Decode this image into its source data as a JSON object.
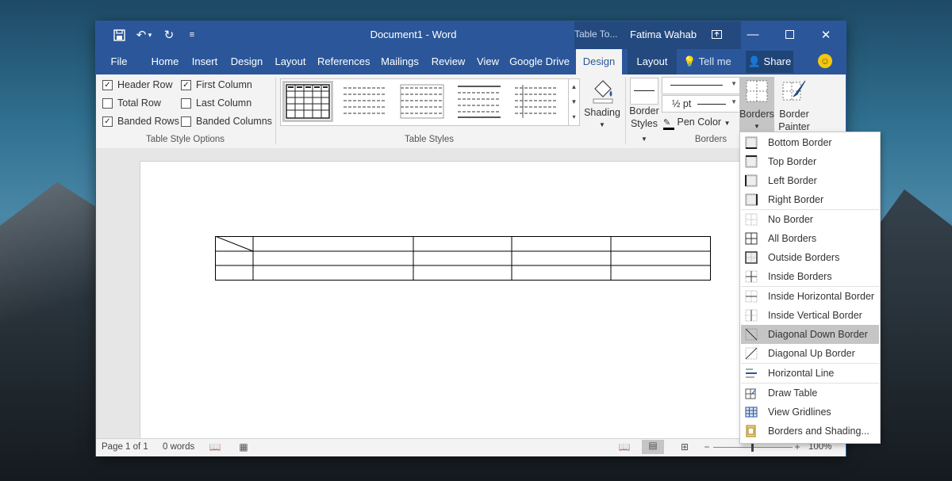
{
  "title_bar": {
    "document_title": "Document1  -  Word",
    "context_group": "Table To...",
    "user_name": "Fatima Wahab"
  },
  "tabs": [
    {
      "label": "File"
    },
    {
      "label": "Home"
    },
    {
      "label": "Insert"
    },
    {
      "label": "Design"
    },
    {
      "label": "Layout"
    },
    {
      "label": "References"
    },
    {
      "label": "Mailings"
    },
    {
      "label": "Review"
    },
    {
      "label": "View"
    },
    {
      "label": "Google Drive"
    },
    {
      "label": "Design"
    },
    {
      "label": "Layout"
    }
  ],
  "tell_me": "Tell me",
  "share": "Share",
  "table_style_options": {
    "group_label": "Table Style Options",
    "options": [
      {
        "label": "Header Row",
        "checked": true
      },
      {
        "label": "First Column",
        "checked": true
      },
      {
        "label": "Total Row",
        "checked": false
      },
      {
        "label": "Last Column",
        "checked": false
      },
      {
        "label": "Banded Rows",
        "checked": true
      },
      {
        "label": "Banded Columns",
        "checked": false
      }
    ]
  },
  "table_styles": {
    "group_label": "Table Styles"
  },
  "shading": {
    "label": "Shading"
  },
  "borders_group": {
    "group_label": "Borders",
    "border_styles_line1": "Border",
    "border_styles_line2": "Styles",
    "pen_weight": "½ pt",
    "pen_color": "Pen Color",
    "borders_button": "Borders",
    "border_painter_line1": "Border",
    "border_painter_line2": "Painter"
  },
  "status_bar": {
    "page": "Page 1 of 1",
    "words": "0 words",
    "zoom": "100%"
  },
  "borders_menu": {
    "items": [
      {
        "label": "Bottom Border",
        "icon": "bottom-border-icon"
      },
      {
        "label": "Top Border",
        "icon": "top-border-icon"
      },
      {
        "label": "Left Border",
        "icon": "left-border-icon"
      },
      {
        "label": "Right Border",
        "icon": "right-border-icon"
      },
      {
        "label": "No Border",
        "icon": "no-border-icon"
      },
      {
        "label": "All Borders",
        "icon": "all-borders-icon"
      },
      {
        "label": "Outside Borders",
        "icon": "outside-borders-icon"
      },
      {
        "label": "Inside Borders",
        "icon": "inside-borders-icon"
      },
      {
        "label": "Inside Horizontal Border",
        "icon": "inside-horizontal-border-icon"
      },
      {
        "label": "Inside Vertical Border",
        "icon": "inside-vertical-border-icon"
      },
      {
        "label": "Diagonal Down Border",
        "icon": "diagonal-down-border-icon",
        "highlighted": true
      },
      {
        "label": "Diagonal Up Border",
        "icon": "diagonal-up-border-icon"
      },
      {
        "label": "Horizontal Line",
        "icon": "horizontal-line-icon"
      },
      {
        "label": "Draw Table",
        "icon": "draw-table-icon"
      },
      {
        "label": "View Gridlines",
        "icon": "view-gridlines-icon"
      },
      {
        "label": "Borders and Shading...",
        "icon": "borders-and-shading-icon"
      }
    ]
  },
  "colors": {
    "word_blue": "#2b579a",
    "context_blue": "#23497f",
    "menu_highlight": "#c5c5c5"
  }
}
